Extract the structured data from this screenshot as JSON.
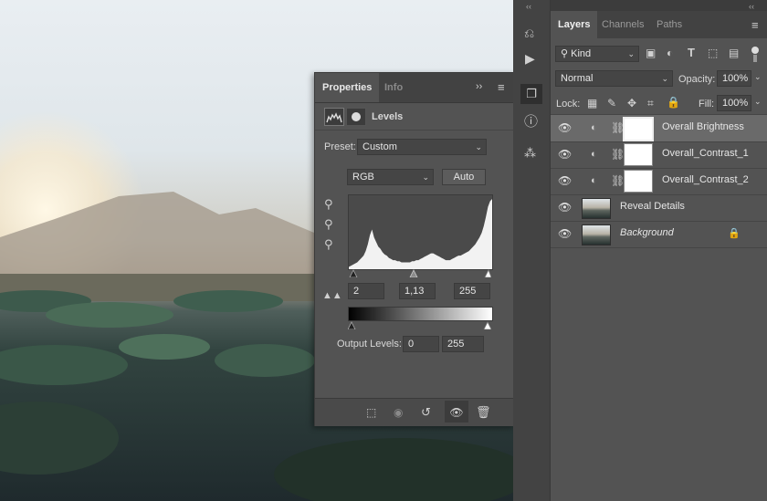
{
  "properties": {
    "tabs": [
      "Properties",
      "Info"
    ],
    "menu_icon": "panel-menu-icon",
    "collapse_icon": "double-chevron-icon",
    "adjustment_title": "Levels",
    "preset_label": "Preset:",
    "preset_value": "Custom",
    "channel_value": "RGB",
    "auto_label": "Auto",
    "input_black": "2",
    "input_gamma": "1,13",
    "input_white": "255",
    "output_label": "Output Levels:",
    "output_black": "0",
    "output_white": "255"
  },
  "layers": {
    "tabs": [
      "Layers",
      "Channels",
      "Paths"
    ],
    "filter_kind": "Kind",
    "blend_mode": "Normal",
    "opacity_label": "Opacity:",
    "opacity_value": "100%",
    "lock_label": "Lock:",
    "fill_label": "Fill:",
    "fill_value": "100%",
    "items": [
      {
        "name": "Overall Brightness",
        "type": "adjustment",
        "selected": true
      },
      {
        "name": "Overall_Contrast_1",
        "type": "adjustment",
        "selected": false
      },
      {
        "name": "Overall_Contrast_2",
        "type": "adjustment",
        "selected": false
      },
      {
        "name": "Reveal Details",
        "type": "pixel",
        "selected": false
      },
      {
        "name": "Background",
        "type": "background",
        "selected": false
      }
    ]
  },
  "histogram": {
    "heights": [
      2,
      3,
      4,
      5,
      6,
      8,
      10,
      12,
      16,
      22,
      30,
      35,
      28,
      24,
      20,
      18,
      15,
      13,
      12,
      10,
      9,
      8,
      8,
      7,
      7,
      6,
      6,
      6,
      6,
      6,
      7,
      7,
      8,
      8,
      9,
      10,
      11,
      12,
      13,
      14,
      14,
      13,
      12,
      11,
      10,
      9,
      8,
      8,
      8,
      9,
      10,
      11,
      12,
      12,
      13,
      14,
      15,
      16,
      18,
      20,
      22,
      25,
      28,
      32,
      38,
      46,
      55,
      60,
      62
    ]
  }
}
